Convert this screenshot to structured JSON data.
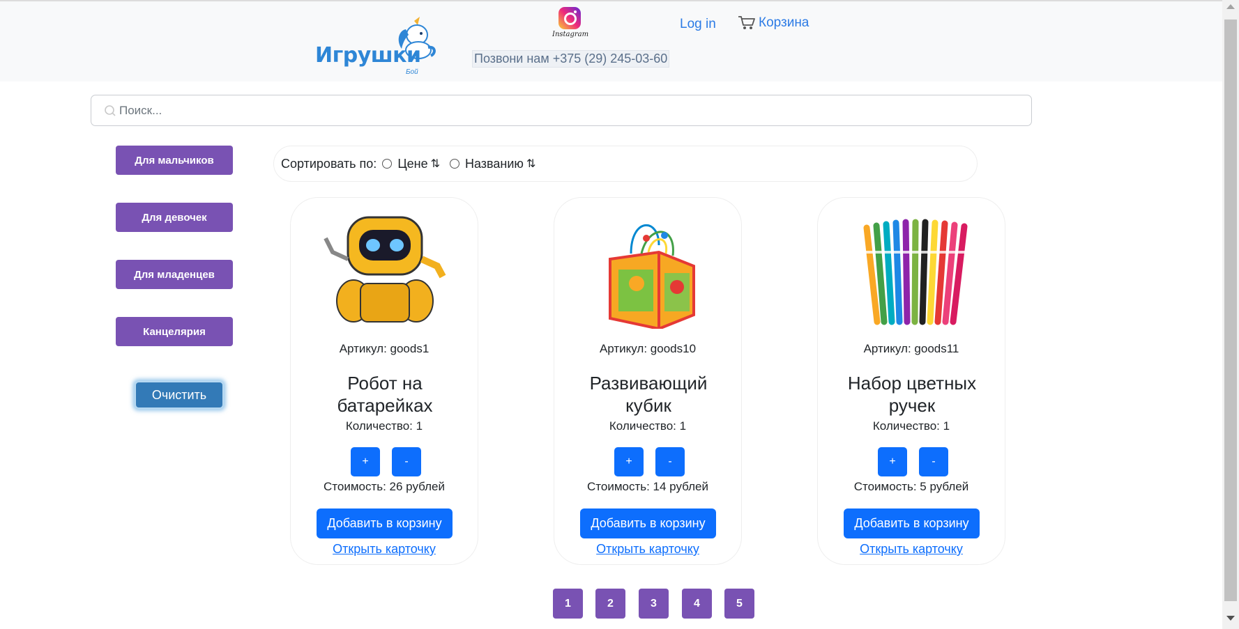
{
  "header": {
    "logo_text": "Игрушки",
    "logo_sub": "Бой",
    "instagram_label": "Instagram",
    "phone": "Позвони нам +375 (29) 245-03-60",
    "login": "Log in",
    "cart": "Корзина"
  },
  "search": {
    "placeholder": "Поиск..."
  },
  "categories": [
    {
      "label": "Для мальчиков"
    },
    {
      "label": "Для девочек"
    },
    {
      "label": "Для младенцев"
    },
    {
      "label": "Канцелярия"
    }
  ],
  "clear_label": "Очистить",
  "sort": {
    "label": "Сортировать по:",
    "options": [
      "Цене",
      "Названию"
    ],
    "arrows": "⇅"
  },
  "products": [
    {
      "article": "Артикул: goods1",
      "title": "Робот на батарейках",
      "quantity": "Количество: 1",
      "plus": "+",
      "minus": "-",
      "price": "Стоимость: 26 рублей",
      "add": "Добавить в корзину",
      "open": "Открыть карточку",
      "image": "robot"
    },
    {
      "article": "Артикул: goods10",
      "title": "Развивающий кубик",
      "quantity": "Количество: 1",
      "plus": "+",
      "minus": "-",
      "price": "Стоимость: 14 рублей",
      "add": "Добавить в корзину",
      "open": "Открыть карточку",
      "image": "cube"
    },
    {
      "article": "Артикул: goods11",
      "title": "Набор цветных ручек",
      "quantity": "Количество: 1",
      "plus": "+",
      "minus": "-",
      "price": "Стоимость: 5 рублей",
      "add": "Добавить в корзину",
      "open": "Открыть карточку",
      "image": "pens"
    }
  ],
  "pagination": [
    "1",
    "2",
    "3",
    "4",
    "5"
  ],
  "colors": {
    "category": "#7952b3",
    "primary": "#0d6efd",
    "clear": "#337ab7",
    "link": "#2c7be5"
  }
}
